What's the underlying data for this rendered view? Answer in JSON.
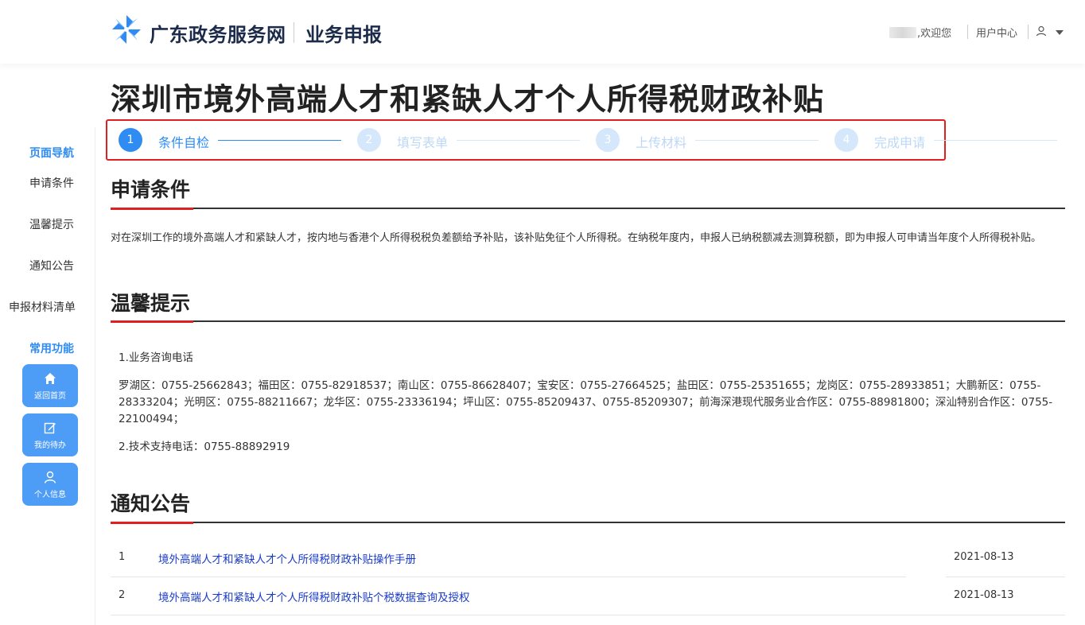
{
  "header": {
    "brand": "广东政务服务网",
    "sub": "业务申报",
    "welcome": ",欢迎您",
    "user_center": "用户中心"
  },
  "page_title": "深圳市境外高端人才和紧缺人才个人所得税财政补贴",
  "steps": [
    {
      "num": "1",
      "label": "条件自检",
      "state": "active"
    },
    {
      "num": "2",
      "label": "填写表单",
      "state": "pending"
    },
    {
      "num": "3",
      "label": "上传材料",
      "state": "pending"
    },
    {
      "num": "4",
      "label": "完成申请",
      "state": "pending"
    }
  ],
  "sidebar": {
    "nav_heading": "页面导航",
    "nav_items": [
      "申请条件",
      "温馨提示",
      "通知公告",
      "申报材料清单"
    ],
    "func_heading": "常用功能",
    "func_buttons": [
      "返回首页",
      "我的待办",
      "个人信息"
    ]
  },
  "sections": {
    "conditions": {
      "title": "申请条件",
      "text": "对在深圳工作的境外高端人才和紧缺人才，按内地与香港个人所得税税负差额给予补贴，该补贴免征个人所得税。在纳税年度内，申报人已纳税额减去测算税额，即为申报人可申请当年度个人所得税补贴。"
    },
    "tips": {
      "title": "温馨提示",
      "line1": "1.业务咨询电话",
      "line2": "罗湖区：0755-25662843；福田区：0755-82918537；南山区：0755-86628407；宝安区：0755-27664525；盐田区：0755-25351655；龙岗区：0755-28933851；大鹏新区：0755-28333204；光明区：0755-88211667；龙华区：0755-23336194；坪山区：0755-85209437、0755-85209307；前海深港现代服务业合作区：0755-88981800；深汕特别合作区：0755-22100494；",
      "line3": "2.技术支持电话：0755-88892919"
    },
    "notices": {
      "title": "通知公告",
      "rows": [
        {
          "num": "1",
          "title": "境外高端人才和紧缺人才个人所得税财政补贴操作手册",
          "date": "2021-08-13"
        },
        {
          "num": "2",
          "title": "境外高端人才和紧缺人才个人所得税财政补贴个税数据查询及授权",
          "date": "2021-08-13"
        }
      ]
    }
  },
  "colors": {
    "primary": "#2f8cf2",
    "accent_red": "#e02020",
    "link": "#1a3cc8"
  }
}
